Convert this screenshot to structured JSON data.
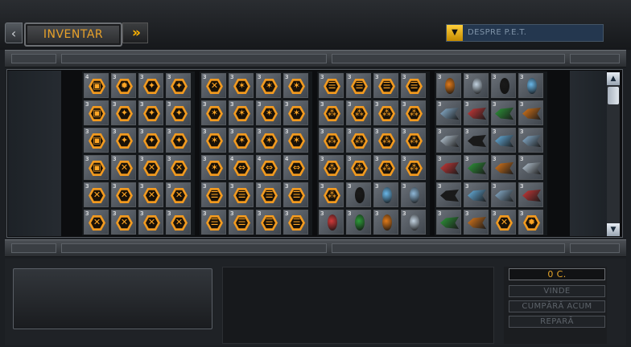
{
  "header": {
    "back_icon": "‹",
    "tab_label": "INVENTAR",
    "next_icon": "»",
    "pet_dropdown_icon": "▼",
    "pet_label": "DESPRE P.E.T."
  },
  "colors": {
    "accent": "#f29a1f",
    "tab_text": "#e8a12a",
    "pet_field": "#24374f"
  },
  "inventory": {
    "group_1": {
      "level_labels": [
        "4",
        "3",
        "3",
        "3",
        "3",
        "3",
        "3",
        "3",
        "3",
        "3",
        "3",
        "3",
        "3",
        "3",
        "3",
        "3",
        "3",
        "3",
        "3",
        "3",
        "3",
        "3",
        "3",
        "3"
      ],
      "icon_names": [
        "cpu-icon",
        "gear-icon",
        "extra-icon",
        "extra-icon",
        "cpu-icon",
        "extra-icon",
        "extra-icon",
        "extra-icon",
        "cpu-icon",
        "extra-icon",
        "extra-icon",
        "extra-icon",
        "cpu-icon",
        "wrench-icon",
        "wrench-icon",
        "wrench-icon",
        "wrench-icon",
        "wrench-icon",
        "wrench-icon",
        "wrench-icon",
        "wrench-icon",
        "wrench-icon",
        "wrench-icon",
        "wrench-icon"
      ]
    },
    "group_2": {
      "level_labels": [
        "3",
        "3",
        "3",
        "3",
        "3",
        "3",
        "3",
        "3",
        "3",
        "3",
        "3",
        "3",
        "3",
        "4",
        "4",
        "4",
        "3",
        "3",
        "3",
        "3",
        "3",
        "3",
        "3",
        "3"
      ],
      "icon_names": [
        "wrench-icon",
        "laser-icon",
        "laser-icon",
        "laser-icon",
        "laser-icon",
        "laser-icon",
        "laser-icon",
        "laser-icon",
        "laser-icon",
        "laser-icon",
        "laser-icon",
        "laser-icon",
        "laser-icon",
        "speed-icon",
        "speed-icon",
        "speed-icon",
        "shield-icon",
        "shield-icon",
        "shield-icon",
        "shield-icon",
        "shield-icon",
        "shield-icon",
        "shield-icon",
        "shield-icon"
      ]
    },
    "group_3": {
      "level_labels": [
        "3",
        "3",
        "3",
        "3",
        "3",
        "3",
        "3",
        "3",
        "3",
        "3",
        "3",
        "3",
        "3",
        "3",
        "3",
        "3",
        "3",
        "3",
        "3",
        "3",
        "3",
        "3",
        "3",
        "3"
      ],
      "icon_names": [
        "shield-icon",
        "shield-icon",
        "shield-icon",
        "shield-icon",
        "triad-icon",
        "triad-icon",
        "triad-icon",
        "triad-icon",
        "triad-icon",
        "triad-icon",
        "triad-icon",
        "triad-icon",
        "triad-icon",
        "triad-icon",
        "triad-icon",
        "triad-icon",
        "triad-icon",
        "drone-icon",
        "drone-icon",
        "drone-icon",
        "drone-icon",
        "drone-icon",
        "drone-icon",
        "drone-icon"
      ]
    },
    "group_4": {
      "level_labels": [
        "3",
        "3",
        "3",
        "3",
        "3",
        "3",
        "3",
        "3",
        "3",
        "3",
        "3",
        "3",
        "3",
        "3",
        "3",
        "3",
        "3",
        "3",
        "3",
        "3",
        "3",
        "3",
        "3",
        "3"
      ],
      "icon_names": [
        "drone-icon",
        "drone-icon",
        "drone-icon",
        "drone-icon",
        "ship-icon",
        "ship-icon",
        "ship-icon",
        "ship-icon",
        "ship-icon",
        "ship-icon",
        "ship-icon",
        "ship-icon",
        "ship-icon",
        "ship-icon",
        "ship-icon",
        "ship-icon",
        "ship-icon",
        "ship-icon",
        "ship-icon",
        "ship-icon",
        "ship-icon",
        "ship-icon",
        "wrench-icon",
        "gear-icon"
      ]
    },
    "scroll_up_icon": "▲",
    "scroll_down_icon": "▼"
  },
  "trade": {
    "credits": "0 C.",
    "sell_label": "VINDE",
    "buy_label": "CUMPĂRĂ ACUM",
    "repair_label": "REPARĂ"
  }
}
